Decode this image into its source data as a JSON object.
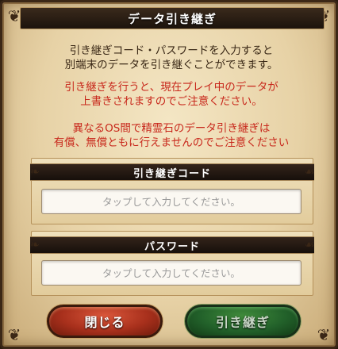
{
  "dialog": {
    "title": "データ引き継ぎ",
    "message_lines": [
      "引き継ぎコード・パスワードを入力すると",
      "別端末のデータを引き継ぐことができます。"
    ],
    "warning1_lines": [
      "引き継ぎを行うと、現在プレイ中のデータが",
      "上書きされますのでご注意ください。"
    ],
    "warning2_lines": [
      "異なるOS間で精霊石のデータ引き継ぎは",
      "有償、無償ともに行えませんのでご注意ください"
    ],
    "colors": {
      "warning_text": "#c8281c",
      "body_text": "#3a2816",
      "close_button": "#a8301c",
      "transfer_button": "#22612a"
    }
  },
  "code_section": {
    "label": "引き継ぎコード",
    "value": "",
    "placeholder": "タップして入力してください。"
  },
  "password_section": {
    "label": "パスワード",
    "value": "",
    "placeholder": "タップして入力してください。"
  },
  "buttons": {
    "close": "閉じる",
    "transfer": "引き継ぎ"
  },
  "icons": {
    "corner": "ornament-corner-icon",
    "curl": "scroll-curl-icon"
  }
}
